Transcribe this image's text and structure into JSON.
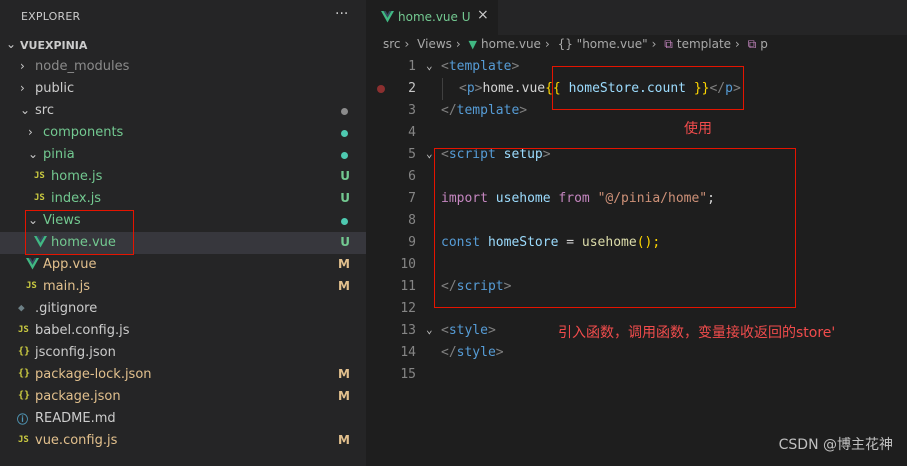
{
  "sidebar": {
    "header": "EXPLORER",
    "more": "···",
    "root": "VUEXPINIA",
    "items": [
      {
        "label": "node_modules",
        "kind": "folder",
        "open": false,
        "badge": "",
        "dot": ""
      },
      {
        "label": "public",
        "kind": "folder",
        "open": false,
        "badge": "",
        "dot": ""
      },
      {
        "label": "src",
        "kind": "folder",
        "open": true,
        "badge": "",
        "dot": "#8c8c8c"
      },
      {
        "label": "components",
        "kind": "folder",
        "open": false,
        "badge": "",
        "dot": "#4ec9b0"
      },
      {
        "label": "pinia",
        "kind": "folder",
        "open": true,
        "badge": "",
        "dot": "#4ec9b0"
      },
      {
        "label": "home.js",
        "kind": "js",
        "badge": "U",
        "dot": ""
      },
      {
        "label": "index.js",
        "kind": "js",
        "badge": "U",
        "dot": ""
      },
      {
        "label": "Views",
        "kind": "folder",
        "open": true,
        "badge": "",
        "dot": "#4ec9b0"
      },
      {
        "label": "home.vue",
        "kind": "vue",
        "badge": "U",
        "dot": ""
      },
      {
        "label": "App.vue",
        "kind": "vue",
        "badge": "M",
        "dot": ""
      },
      {
        "label": "main.js",
        "kind": "js",
        "badge": "M",
        "dot": ""
      },
      {
        "label": ".gitignore",
        "kind": "git",
        "badge": "",
        "dot": ""
      },
      {
        "label": "babel.config.js",
        "kind": "js",
        "badge": "",
        "dot": ""
      },
      {
        "label": "jsconfig.json",
        "kind": "json",
        "badge": "",
        "dot": ""
      },
      {
        "label": "package-lock.json",
        "kind": "json",
        "badge": "M",
        "dot": ""
      },
      {
        "label": "package.json",
        "kind": "json",
        "badge": "M",
        "dot": ""
      },
      {
        "label": "README.md",
        "kind": "info",
        "badge": "",
        "dot": ""
      },
      {
        "label": "vue.config.js",
        "kind": "js",
        "badge": "M",
        "dot": ""
      }
    ]
  },
  "tab": {
    "label": "home.vue",
    "badge": "U",
    "close": "×"
  },
  "breadcrumb": [
    "src",
    "Views",
    "home.vue",
    "{} \"home.vue\"",
    "template",
    "p"
  ],
  "breadcrumb_sep": "›",
  "code": {
    "line1_tag": "template",
    "line2_tag": "p",
    "line2_text": "home.vue",
    "line2_mustache_open": "{{",
    "line2_expr": "homeStore.count",
    "line2_mustache_close": "}}",
    "line3_tag": "template",
    "line5_tag": "script",
    "line5_attr": "setup",
    "line7_import": "import",
    "line7_name": "usehome",
    "line7_from": "from",
    "line7_path": "\"@/pinia/home\"",
    "line9_const": "const",
    "line9_var": "homeStore",
    "line9_eq": "=",
    "line9_fn": "usehome",
    "line9_call": "();",
    "line11_tag": "script",
    "line13_tag": "style",
    "line14_tag": "style",
    "line_numbers": [
      "1",
      "2",
      "3",
      "4",
      "5",
      "6",
      "7",
      "8",
      "9",
      "10",
      "11",
      "12",
      "13",
      "14",
      "15"
    ]
  },
  "annotations": {
    "use_label": "使用",
    "import_label": "引入函数，调用函数，变量接收返回的store'"
  },
  "watermark": "CSDN @博主花神",
  "colors": {
    "vue_green": "#41b883",
    "js_yellow": "#cbcb41",
    "json_yellow": "#cbcb41",
    "untracked": "#73c991",
    "modified": "#e2c08d",
    "annotation_red": "#e51400"
  }
}
